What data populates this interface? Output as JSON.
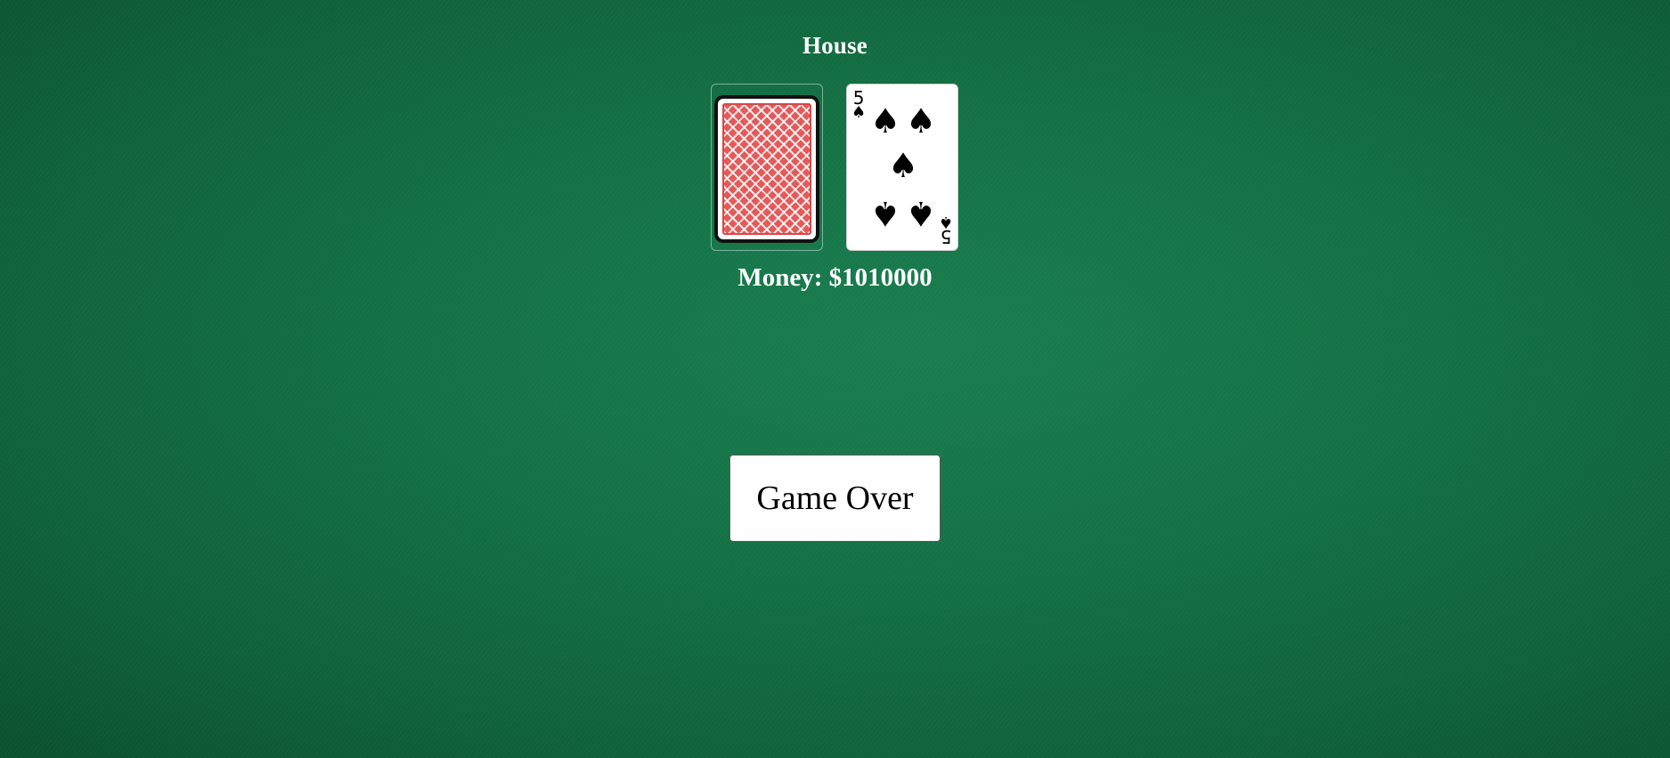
{
  "dealer": {
    "label": "House",
    "money": "Money: $1010000",
    "cards": [
      {
        "face": "down",
        "back_color": "#e45a5a"
      },
      {
        "face": "up",
        "rank": "5",
        "suit": "♠",
        "suit_name": "spades",
        "color": "#000000"
      }
    ]
  },
  "actions": {
    "game_over_label": "Game Over"
  },
  "colors": {
    "felt": "#157447",
    "text": "#ffffff"
  }
}
